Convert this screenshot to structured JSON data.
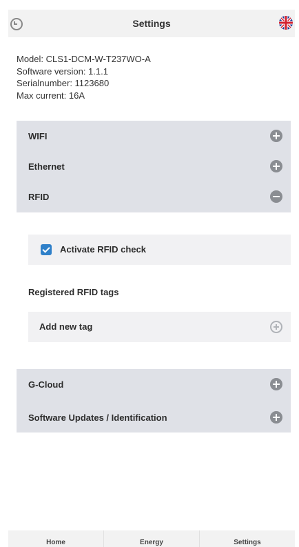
{
  "header": {
    "title": "Settings",
    "back_icon": "circle-back-icon",
    "language_icon": "uk-flag-icon"
  },
  "device_info": {
    "model": "Model: CLS1-DCM-W-T237WO-A",
    "software_version": "Software version: 1.1.1",
    "serial_number": "Serialnumber: 1123680",
    "max_current": "Max current: 16A"
  },
  "sections": {
    "wifi": {
      "label": "WIFI",
      "icon": "plus-circle-icon",
      "expanded": false
    },
    "ethernet": {
      "label": "Ethernet",
      "icon": "plus-circle-icon",
      "expanded": false
    },
    "rfid": {
      "label": "RFID",
      "icon": "minus-circle-icon",
      "expanded": true,
      "activate_label": "Activate RFID check",
      "activate_checked": true,
      "registered_tags_label": "Registered RFID tags",
      "add_tag_label": "Add new tag"
    },
    "gcloud": {
      "label": "G-Cloud",
      "icon": "plus-circle-icon",
      "expanded": false
    },
    "software_updates": {
      "label": "Software Updates / Identification",
      "icon": "plus-circle-icon",
      "expanded": false
    }
  },
  "bottom_nav": {
    "home": "Home",
    "energy": "Energy",
    "settings": "Settings",
    "active": "Settings"
  },
  "colors": {
    "accordion_bg": "#dfe1e7",
    "checkbox_accent": "#2f80c9",
    "icon_gray": "#8a8d92"
  }
}
